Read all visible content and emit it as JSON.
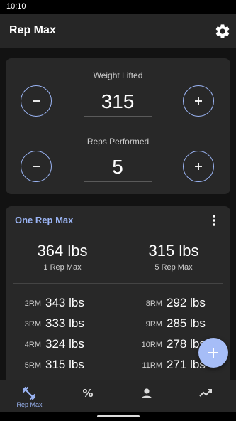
{
  "status_bar": {
    "time": "10:10"
  },
  "app_bar": {
    "title": "Rep Max",
    "settings_icon": "gear-icon"
  },
  "inputs": {
    "weight_label": "Weight Lifted",
    "weight_value": "315",
    "reps_label": "Reps Performed",
    "reps_value": "5",
    "minus_icon": "minus-icon",
    "plus_icon": "plus-icon"
  },
  "one_rep_max": {
    "title": "One Rep Max",
    "primary": {
      "value": "364 lbs",
      "label": "1 Rep Max"
    },
    "secondary": {
      "value": "315 lbs",
      "label": "5 Rep Max"
    },
    "left_rows": [
      {
        "key": "2RM",
        "value": "343 lbs"
      },
      {
        "key": "3RM",
        "value": "333 lbs"
      },
      {
        "key": "4RM",
        "value": "324 lbs"
      },
      {
        "key": "5RM",
        "value": "315 lbs"
      }
    ],
    "right_rows": [
      {
        "key": "8RM",
        "value": "292 lbs"
      },
      {
        "key": "9RM",
        "value": "285 lbs"
      },
      {
        "key": "10RM",
        "value": "278 lbs"
      },
      {
        "key": "11RM",
        "value": "271 lbs"
      }
    ]
  },
  "bottom_nav": {
    "items": [
      {
        "label": "Rep Max",
        "icon": "rep-max-icon",
        "active": true
      },
      {
        "label": "",
        "icon": "percent-icon",
        "active": false
      },
      {
        "label": "",
        "icon": "person-icon",
        "active": false
      },
      {
        "label": "",
        "icon": "trending-icon",
        "active": false
      }
    ]
  },
  "colors": {
    "accent": "#9bb5f5",
    "fab": "#a6bdf7",
    "card": "#282828",
    "background": "#121212"
  }
}
